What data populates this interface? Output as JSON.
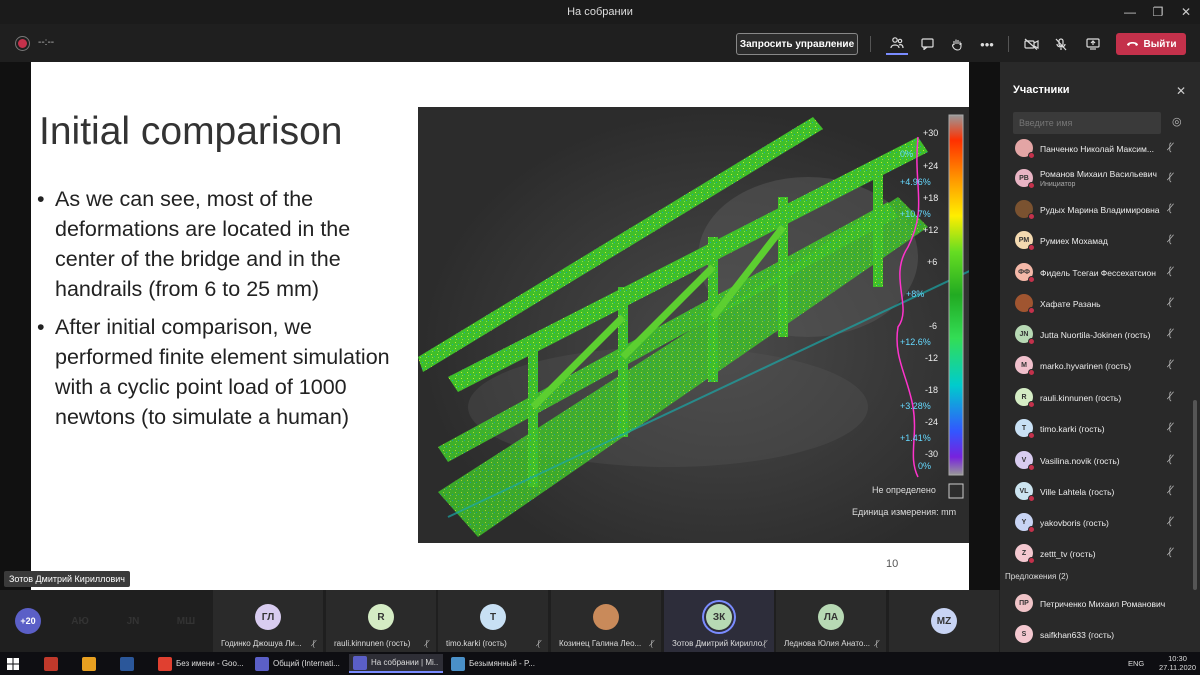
{
  "window": {
    "title": "На собрании"
  },
  "meeting": {
    "timer": "--:--",
    "request_control": "Запросить управление",
    "leave": "Выйти"
  },
  "slide": {
    "title": "Initial comparison",
    "bullets": [
      "As we can see, most of the deformations are located in the center of the bridge and in the handrails (from 6 to 25 mm)",
      "After initial comparison, we performed finite element simulation with a cyclic point load of 1000 newtons (to simulate a human)"
    ],
    "page_number": "10",
    "scale_labels": [
      "+30",
      "+24",
      "+18",
      "+12",
      "+6",
      "-6",
      "-12",
      "-18",
      "-24",
      "-30"
    ],
    "percent_labels": [
      "0%",
      "+4.96%",
      "+10.7%",
      "+8%",
      "+12.6%",
      "+3.28%",
      "+1.41%",
      "0%"
    ],
    "undefined_label": "Не определено",
    "unit_label": "Единица измерения: mm"
  },
  "presenter": "Зотов Дмитрий Кириллович",
  "panel": {
    "title": "Участники",
    "search_placeholder": "Введите имя",
    "participants": [
      {
        "initials": "",
        "name": "Панченко Николай Максим...",
        "sub": "",
        "color": "#e3a5a5"
      },
      {
        "initials": "РВ",
        "name": "Романов Михаил Васильевич",
        "sub": "Инициатор",
        "color": "#e8b4c4"
      },
      {
        "initials": "",
        "name": "Рудых Марина Владимировна",
        "sub": "",
        "color": "#7a5230"
      },
      {
        "initials": "РМ",
        "name": "Румиех Мохамад",
        "sub": "",
        "color": "#f3d9b0"
      },
      {
        "initials": "ФФ",
        "name": "Фидель Тсегаи Фессехатсион",
        "sub": "",
        "color": "#f4b8a8"
      },
      {
        "initials": "",
        "name": "Хафате Разань",
        "sub": "",
        "color": "#a05530"
      },
      {
        "initials": "JN",
        "name": "Jutta Nuortila-Jokinen (гость)",
        "sub": "",
        "color": "#b7d9b4"
      },
      {
        "initials": "M",
        "name": "marko.hyvarinen (гость)",
        "sub": "",
        "color": "#f0c0cc"
      },
      {
        "initials": "R",
        "name": "rauli.kinnunen (гость)",
        "sub": "",
        "color": "#d4ecc4"
      },
      {
        "initials": "T",
        "name": "timo.karki (гость)",
        "sub": "",
        "color": "#c8e0f4"
      },
      {
        "initials": "V",
        "name": "Vasilina.novik (гость)",
        "sub": "",
        "color": "#d8ccf0"
      },
      {
        "initials": "VL",
        "name": "Ville Lahtela (гость)",
        "sub": "",
        "color": "#cce4f0"
      },
      {
        "initials": "Y",
        "name": "yakovboris (гость)",
        "sub": "",
        "color": "#c8d4f4"
      },
      {
        "initials": "Z",
        "name": "zettt_tv (гость)",
        "sub": "",
        "color": "#f4c8d0"
      }
    ],
    "suggestions_label": "Предложения (2)",
    "suggestions": [
      {
        "initials": "ПР",
        "name": "Петриченко Михаил Романович",
        "color": "#f0c4c8"
      },
      {
        "initials": "S",
        "name": "saifkhan633 (гость)",
        "color": "#f4c8d0"
      }
    ]
  },
  "strip": {
    "more": "+20",
    "avatars": [
      {
        "initials": "АЮ",
        "color": "#b7d9b4"
      },
      {
        "initials": "JN",
        "color": "#b7d9b4"
      },
      {
        "initials": "МШ",
        "color": "#b7d9b4"
      }
    ],
    "tiles": [
      {
        "initials": "ГЛ",
        "name": "Годинко Джошуа Ли...",
        "color": "#d8ccf0"
      },
      {
        "initials": "R",
        "name": "rauli.kinnunen (гость)",
        "color": "#d4ecc4"
      },
      {
        "initials": "T",
        "name": "timo.karki (гость)",
        "color": "#c8e0f4"
      },
      {
        "initials": "",
        "name": "Козинец Галина Лео...",
        "color": "#c98a5a"
      },
      {
        "initials": "ЗК",
        "name": "Зотов Дмитрий Кирилло...",
        "color": "#b7d9b4"
      },
      {
        "initials": "ЛА",
        "name": "Леднова Юлия Анато...",
        "color": "#b7d9b4"
      },
      {
        "initials": "MZ",
        "name": "",
        "color": "#c8d4f4"
      }
    ]
  },
  "taskbar": {
    "apps": [
      {
        "label": "",
        "color": "#c0392b"
      },
      {
        "label": "",
        "color": "#e8a020"
      },
      {
        "label": "",
        "color": "#2b579a"
      },
      {
        "label": "Без имени - Goo...",
        "color": "#e04030"
      },
      {
        "label": "Общий (Internati...",
        "color": "#5b5fc7"
      },
      {
        "label": "На собрании | Mi...",
        "color": "#5b5fc7"
      },
      {
        "label": "Безымянный - P...",
        "color": "#4a90c8"
      }
    ],
    "lang": "ENG",
    "time": "10:30",
    "date": "27.11.2020"
  }
}
